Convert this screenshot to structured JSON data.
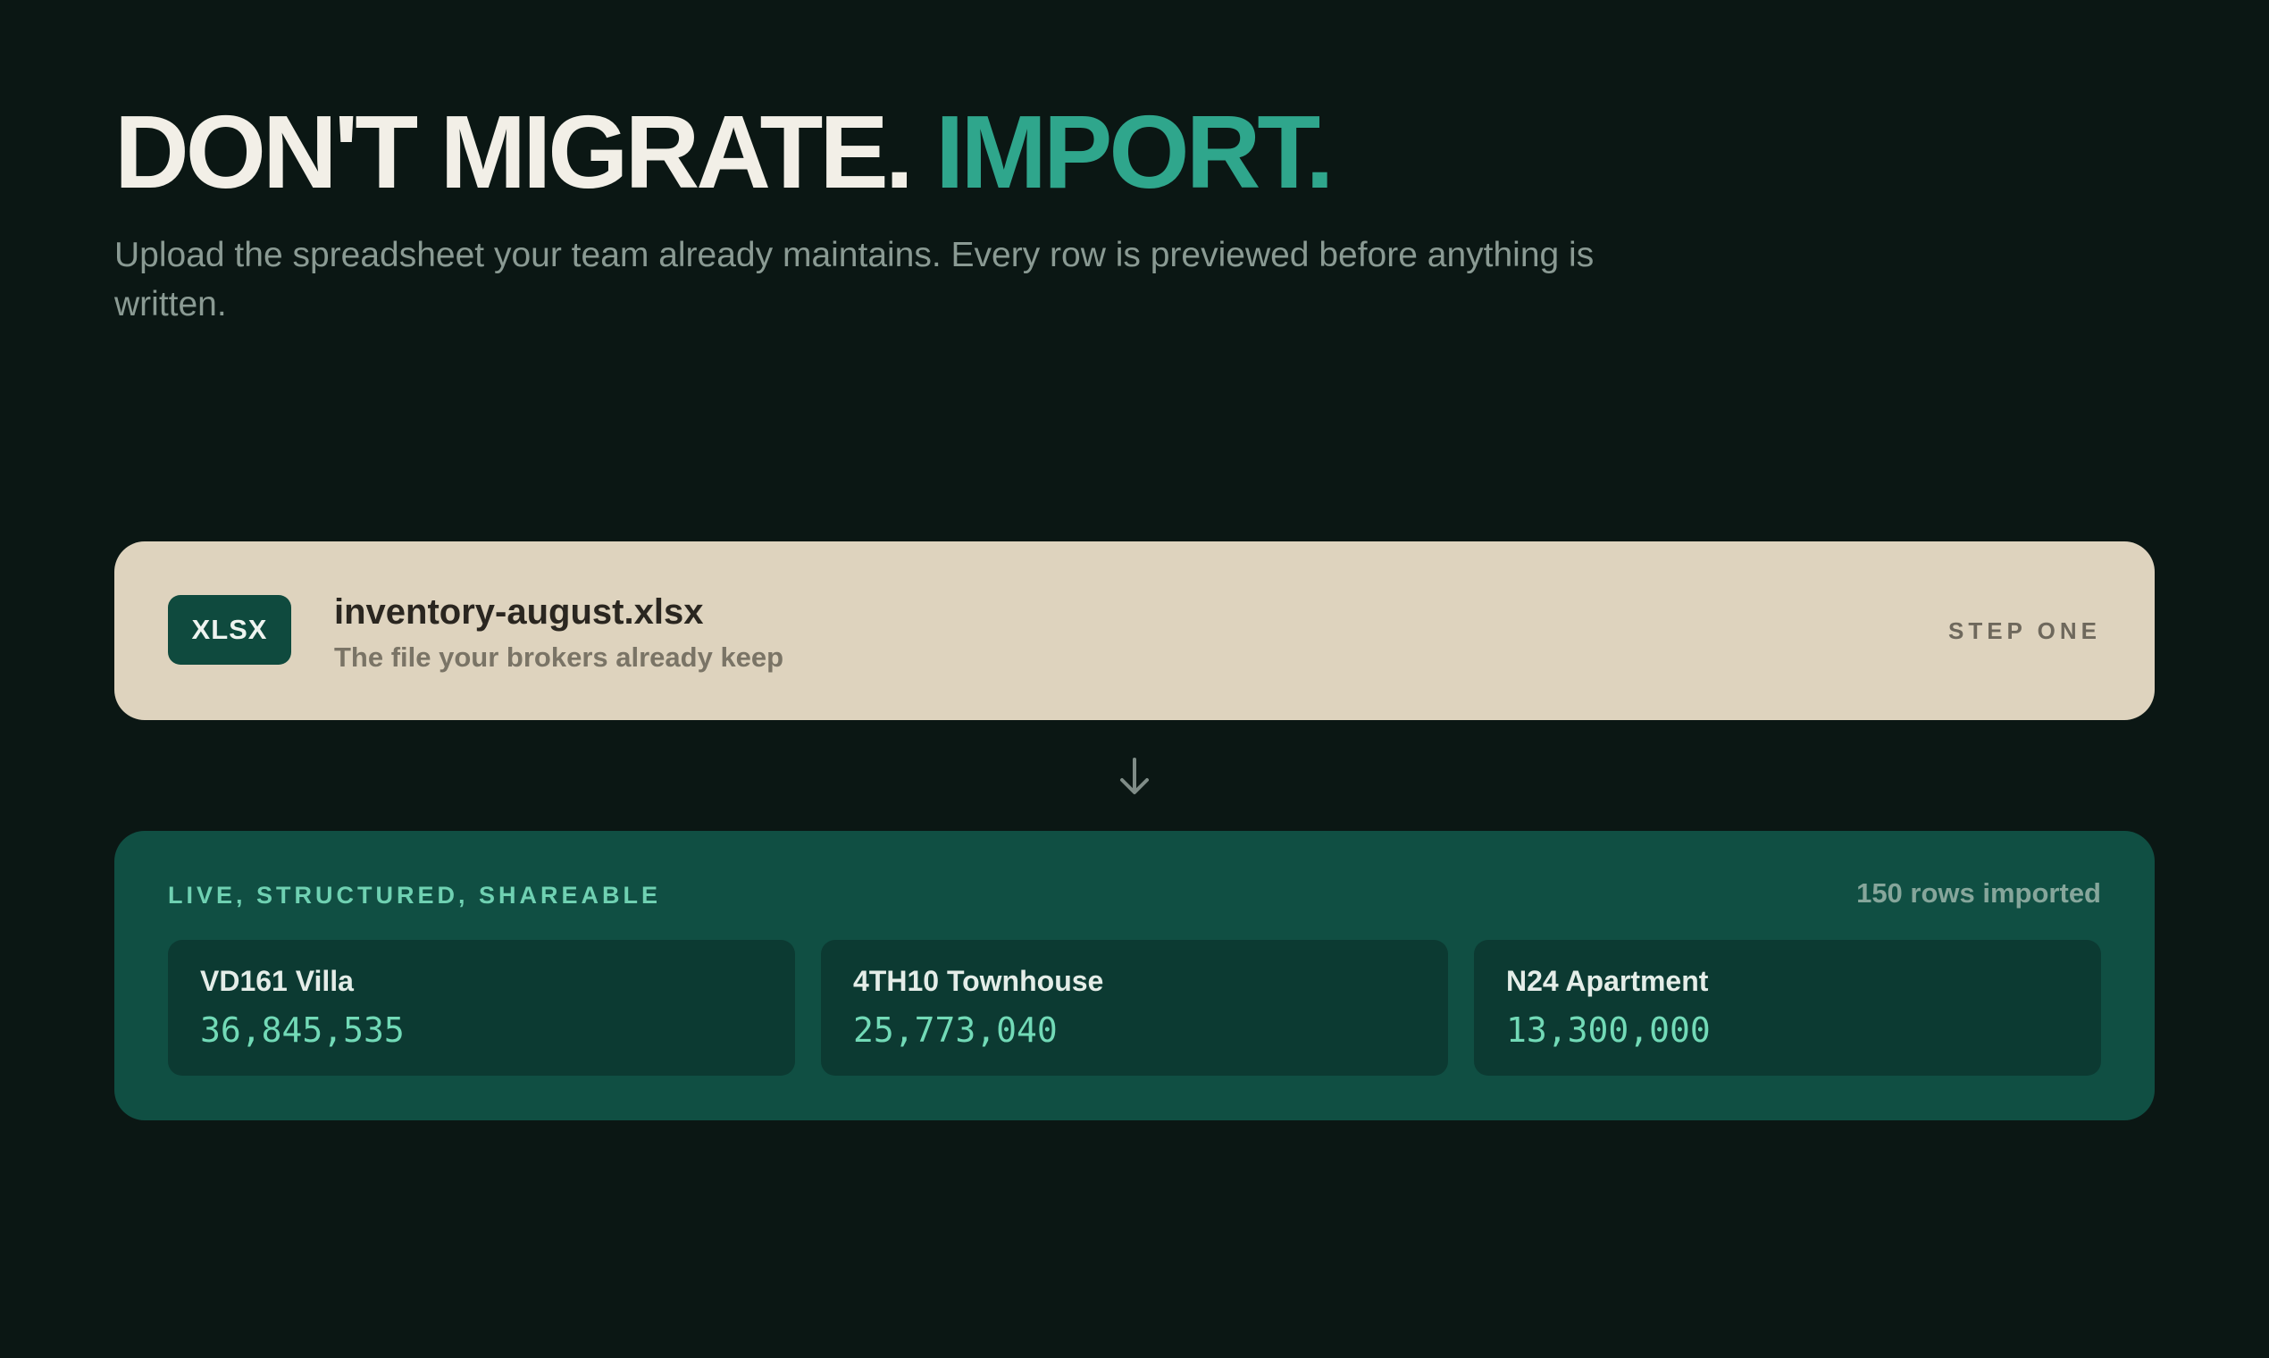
{
  "hero": {
    "title_main": "DON'T MIGRATE.",
    "title_accent": "IMPORT.",
    "subtitle": "Upload the spreadsheet your team already maintains. Every row is previewed before anything is written."
  },
  "source_file": {
    "badge": "XLSX",
    "name": "inventory-august.xlsx",
    "description": "The file your brokers already keep",
    "step": "STEP ONE"
  },
  "arrow_icon": "arrow-down-icon",
  "result": {
    "label": "LIVE, STRUCTURED, SHAREABLE",
    "count": "150 rows imported",
    "listings": [
      {
        "name": "VD161 Villa",
        "price": "36,845,535"
      },
      {
        "name": "4TH10 Townhouse",
        "price": "25,773,040"
      },
      {
        "name": "N24 Apartment",
        "price": "13,300,000"
      }
    ]
  },
  "colors": {
    "background": "#0b1714",
    "accent": "#2fa68c",
    "file_card": "#ded3be",
    "result_card": "#104f43",
    "listing_card": "#0c3a32",
    "price_text": "#72dab7"
  }
}
